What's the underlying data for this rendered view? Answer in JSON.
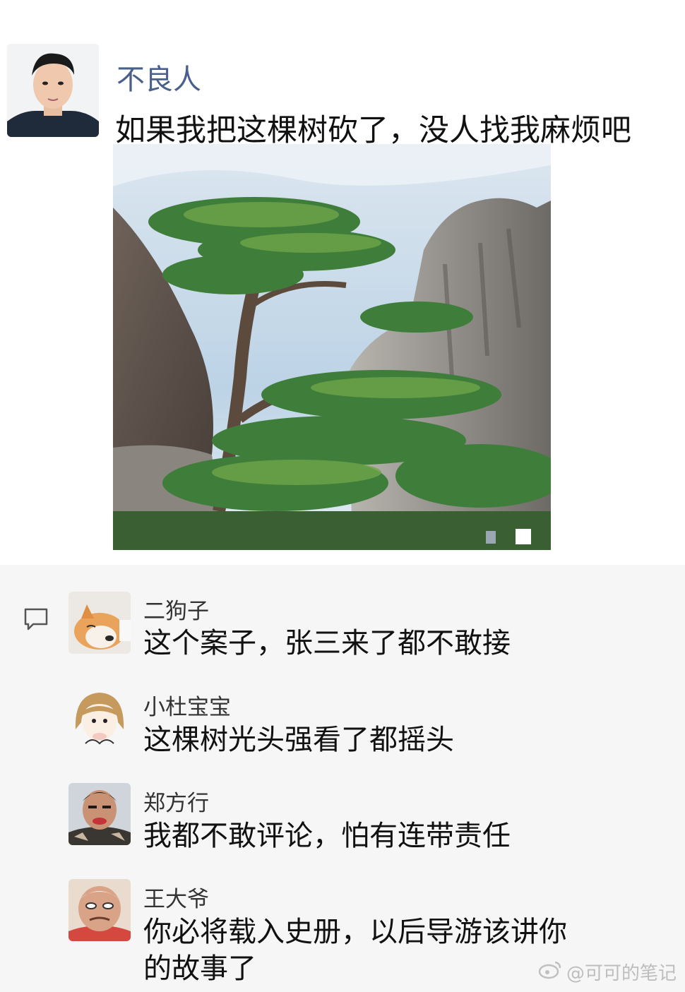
{
  "post": {
    "author": "不良人",
    "text": "如果我把这棵树砍了，没人找我麻烦吧",
    "image_icon": "pine-tree-landscape-photo"
  },
  "comments": [
    {
      "name": "二狗子",
      "text": "这个案子，张三来了都不敢接",
      "avatar_icon": "shiba-dog-avatar"
    },
    {
      "name": "小杜宝宝",
      "text": "这棵树光头强看了都摇头",
      "avatar_icon": "cartoon-girl-avatar"
    },
    {
      "name": "郑方行",
      "text": "我都不敢评论，怕有连带责任",
      "avatar_icon": "man-photo-avatar"
    },
    {
      "name": "王大爷",
      "text": "你必将载入史册，以后导游该讲你的故事了",
      "avatar_icon": "old-man-avatar"
    }
  ],
  "icons": {
    "comment": "comment-icon",
    "watermark_logo": "weibo-logo-icon"
  },
  "watermark": "@可可的笔记"
}
